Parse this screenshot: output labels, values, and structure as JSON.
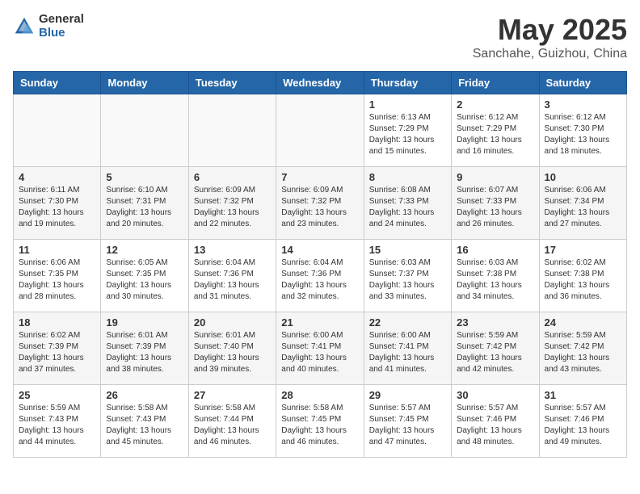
{
  "header": {
    "logo_general": "General",
    "logo_blue": "Blue",
    "month": "May 2025",
    "location": "Sanchahe, Guizhou, China"
  },
  "weekdays": [
    "Sunday",
    "Monday",
    "Tuesday",
    "Wednesday",
    "Thursday",
    "Friday",
    "Saturday"
  ],
  "weeks": [
    [
      {
        "day": "",
        "info": ""
      },
      {
        "day": "",
        "info": ""
      },
      {
        "day": "",
        "info": ""
      },
      {
        "day": "",
        "info": ""
      },
      {
        "day": "1",
        "info": "Sunrise: 6:13 AM\nSunset: 7:29 PM\nDaylight: 13 hours and 15 minutes."
      },
      {
        "day": "2",
        "info": "Sunrise: 6:12 AM\nSunset: 7:29 PM\nDaylight: 13 hours and 16 minutes."
      },
      {
        "day": "3",
        "info": "Sunrise: 6:12 AM\nSunset: 7:30 PM\nDaylight: 13 hours and 18 minutes."
      }
    ],
    [
      {
        "day": "4",
        "info": "Sunrise: 6:11 AM\nSunset: 7:30 PM\nDaylight: 13 hours and 19 minutes."
      },
      {
        "day": "5",
        "info": "Sunrise: 6:10 AM\nSunset: 7:31 PM\nDaylight: 13 hours and 20 minutes."
      },
      {
        "day": "6",
        "info": "Sunrise: 6:09 AM\nSunset: 7:32 PM\nDaylight: 13 hours and 22 minutes."
      },
      {
        "day": "7",
        "info": "Sunrise: 6:09 AM\nSunset: 7:32 PM\nDaylight: 13 hours and 23 minutes."
      },
      {
        "day": "8",
        "info": "Sunrise: 6:08 AM\nSunset: 7:33 PM\nDaylight: 13 hours and 24 minutes."
      },
      {
        "day": "9",
        "info": "Sunrise: 6:07 AM\nSunset: 7:33 PM\nDaylight: 13 hours and 26 minutes."
      },
      {
        "day": "10",
        "info": "Sunrise: 6:06 AM\nSunset: 7:34 PM\nDaylight: 13 hours and 27 minutes."
      }
    ],
    [
      {
        "day": "11",
        "info": "Sunrise: 6:06 AM\nSunset: 7:35 PM\nDaylight: 13 hours and 28 minutes."
      },
      {
        "day": "12",
        "info": "Sunrise: 6:05 AM\nSunset: 7:35 PM\nDaylight: 13 hours and 30 minutes."
      },
      {
        "day": "13",
        "info": "Sunrise: 6:04 AM\nSunset: 7:36 PM\nDaylight: 13 hours and 31 minutes."
      },
      {
        "day": "14",
        "info": "Sunrise: 6:04 AM\nSunset: 7:36 PM\nDaylight: 13 hours and 32 minutes."
      },
      {
        "day": "15",
        "info": "Sunrise: 6:03 AM\nSunset: 7:37 PM\nDaylight: 13 hours and 33 minutes."
      },
      {
        "day": "16",
        "info": "Sunrise: 6:03 AM\nSunset: 7:38 PM\nDaylight: 13 hours and 34 minutes."
      },
      {
        "day": "17",
        "info": "Sunrise: 6:02 AM\nSunset: 7:38 PM\nDaylight: 13 hours and 36 minutes."
      }
    ],
    [
      {
        "day": "18",
        "info": "Sunrise: 6:02 AM\nSunset: 7:39 PM\nDaylight: 13 hours and 37 minutes."
      },
      {
        "day": "19",
        "info": "Sunrise: 6:01 AM\nSunset: 7:39 PM\nDaylight: 13 hours and 38 minutes."
      },
      {
        "day": "20",
        "info": "Sunrise: 6:01 AM\nSunset: 7:40 PM\nDaylight: 13 hours and 39 minutes."
      },
      {
        "day": "21",
        "info": "Sunrise: 6:00 AM\nSunset: 7:41 PM\nDaylight: 13 hours and 40 minutes."
      },
      {
        "day": "22",
        "info": "Sunrise: 6:00 AM\nSunset: 7:41 PM\nDaylight: 13 hours and 41 minutes."
      },
      {
        "day": "23",
        "info": "Sunrise: 5:59 AM\nSunset: 7:42 PM\nDaylight: 13 hours and 42 minutes."
      },
      {
        "day": "24",
        "info": "Sunrise: 5:59 AM\nSunset: 7:42 PM\nDaylight: 13 hours and 43 minutes."
      }
    ],
    [
      {
        "day": "25",
        "info": "Sunrise: 5:59 AM\nSunset: 7:43 PM\nDaylight: 13 hours and 44 minutes."
      },
      {
        "day": "26",
        "info": "Sunrise: 5:58 AM\nSunset: 7:43 PM\nDaylight: 13 hours and 45 minutes."
      },
      {
        "day": "27",
        "info": "Sunrise: 5:58 AM\nSunset: 7:44 PM\nDaylight: 13 hours and 46 minutes."
      },
      {
        "day": "28",
        "info": "Sunrise: 5:58 AM\nSunset: 7:45 PM\nDaylight: 13 hours and 46 minutes."
      },
      {
        "day": "29",
        "info": "Sunrise: 5:57 AM\nSunset: 7:45 PM\nDaylight: 13 hours and 47 minutes."
      },
      {
        "day": "30",
        "info": "Sunrise: 5:57 AM\nSunset: 7:46 PM\nDaylight: 13 hours and 48 minutes."
      },
      {
        "day": "31",
        "info": "Sunrise: 5:57 AM\nSunset: 7:46 PM\nDaylight: 13 hours and 49 minutes."
      }
    ]
  ]
}
